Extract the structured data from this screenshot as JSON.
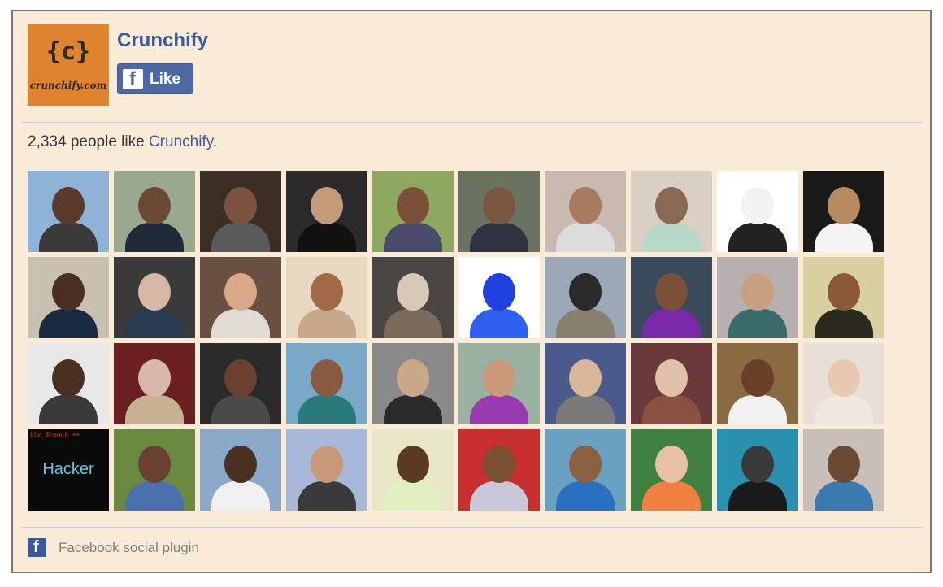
{
  "page": {
    "name": "Crunchify",
    "logo_braces": "{c}",
    "logo_text": "crunchify.com"
  },
  "like_button": {
    "label": "Like"
  },
  "summary": {
    "count": "2,334",
    "text": "people like",
    "page_link": "Crunchify",
    "suffix": "."
  },
  "footer": {
    "text": "Facebook social plugin"
  },
  "faces": [
    {
      "bg": "#8fb3d6",
      "head": "#5b3a29",
      "body": "#3a3a3a"
    },
    {
      "bg": "#9aa890",
      "head": "#6b4a35",
      "body": "#1f2a38"
    },
    {
      "bg": "#3a2e25",
      "head": "#7a5440",
      "body": "#5a5a5a"
    },
    {
      "bg": "#2a2a2a",
      "head": "#c59a78",
      "body": "#111111"
    },
    {
      "bg": "#8fa860",
      "head": "#7a5039",
      "body": "#4a4a6a"
    },
    {
      "bg": "#6a7260",
      "head": "#7a5540",
      "body": "#2d3440"
    },
    {
      "bg": "#c9b9b0",
      "head": "#a77a60",
      "body": "#dcdcdc"
    },
    {
      "bg": "#d9cfc3",
      "head": "#8a6a55",
      "body": "#b8d8c8"
    },
    {
      "bg": "#ffffff",
      "head": "#f2f2f2",
      "body": "#222222"
    },
    {
      "bg": "#1a1a1a",
      "head": "#b88a60",
      "body": "#f4f4f4"
    },
    {
      "bg": "#c8c0b0",
      "head": "#4a3020",
      "body": "#1a2a40"
    },
    {
      "bg": "#3a3a3a",
      "head": "#d6b8a4",
      "body": "#2a3a50"
    },
    {
      "bg": "#6a5040",
      "head": "#d8a888",
      "body": "#e0dcd4"
    },
    {
      "bg": "#e8d8c0",
      "head": "#a06a48",
      "body": "#c8a888"
    },
    {
      "bg": "#4a4540",
      "head": "#d8c8b8",
      "body": "#7a6a5a"
    },
    {
      "bg": "#ffffff",
      "head": "#2040e0",
      "body": "#3060f0"
    },
    {
      "bg": "#9aa8b8",
      "head": "#2a2a2a",
      "body": "#8a8070"
    },
    {
      "bg": "#3a4a5a",
      "head": "#7a5038",
      "body": "#7a2aa8"
    },
    {
      "bg": "#b8b0b0",
      "head": "#c8a080",
      "body": "#3a6a6a"
    },
    {
      "bg": "#d8d0a0",
      "head": "#8a5a38",
      "body": "#2a2a20"
    },
    {
      "bg": "#e8e8e8",
      "head": "#4a3020",
      "body": "#3a3a3a"
    },
    {
      "bg": "#6a2020",
      "head": "#d8b8a8",
      "body": "#c8b090"
    },
    {
      "bg": "#2a2a2a",
      "head": "#6a4030",
      "body": "#4a4a4a"
    },
    {
      "bg": "#7aa8c8",
      "head": "#8a5a40",
      "body": "#2a7a7a"
    },
    {
      "bg": "#8a8a8a",
      "head": "#c8a888",
      "body": "#2a2a2a"
    },
    {
      "bg": "#9ab0a0",
      "head": "#c89878",
      "body": "#9a3ab0"
    },
    {
      "bg": "#4a5a8a",
      "head": "#d8b898",
      "body": "#7a7a7a"
    },
    {
      "bg": "#6a3a3a",
      "head": "#e0c0a8",
      "body": "#8a5040"
    },
    {
      "bg": "#8a6a40",
      "head": "#6a4028",
      "body": "#f0f0f0"
    },
    {
      "bg": "#e8e0d8",
      "head": "#e8c8b0",
      "body": "#f0e8e0"
    },
    {
      "bg": "#0a0a0a",
      "head": "#0a0a0a",
      "body": "#0a0a0a"
    },
    {
      "bg": "#6a8a40",
      "head": "#6a4030",
      "body": "#4a70b0"
    },
    {
      "bg": "#8aa8c8",
      "head": "#4a3020",
      "body": "#f0f0f0"
    },
    {
      "bg": "#a8b8d8",
      "head": "#c89878",
      "body": "#3a3a3a"
    },
    {
      "bg": "#e8e8c8",
      "head": "#5a3a20",
      "body": "#e0f0c0"
    },
    {
      "bg": "#c83030",
      "head": "#7a5030",
      "body": "#c8c8d8"
    },
    {
      "bg": "#6aa0c0",
      "head": "#8a6040",
      "body": "#2a70c0"
    },
    {
      "bg": "#408040",
      "head": "#e8c0a8",
      "body": "#f08040"
    },
    {
      "bg": "#2a90b0",
      "head": "#3a3a3a",
      "body": "#1a1a1a"
    },
    {
      "bg": "#c8c0b8",
      "head": "#6a4a30",
      "body": "#3a7ab0"
    }
  ],
  "hacker_tile": {
    "text": "Hacker",
    "badge": "ity Breach <<"
  }
}
